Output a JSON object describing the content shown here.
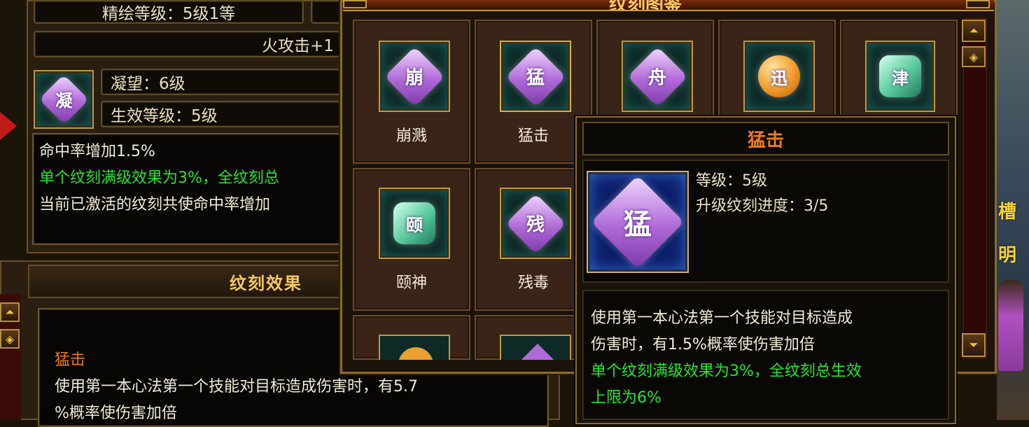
{
  "left_panel": {
    "refine_level_label": "精绘等级：5级1等",
    "fire_attack_label": "火攻击+1",
    "icon_char": "凝",
    "gaze_label": "凝望：6级",
    "effect_level_label": "生效等级：5级",
    "desc_lines": [
      "命中率增加1.5%",
      "单个纹刻满级效果为3%，全纹刻总",
      "当前已激活的纹刻共使命中率增加"
    ]
  },
  "effects_panel": {
    "title": "纹刻效果",
    "entry_name": "猛击",
    "entry_desc_line1": "使用第一本心法第一个技能对目标造成伤害时，有5.7",
    "entry_desc_line2": "%概率使伤害加倍"
  },
  "grid_window": {
    "title": "纹刻图鉴",
    "cells": [
      {
        "icon_char": "崩",
        "label": "崩溅",
        "icon_style": "purple"
      },
      {
        "icon_char": "猛",
        "label": "猛击",
        "icon_style": "purple"
      },
      {
        "icon_char": "舟",
        "label": "",
        "icon_style": "purple"
      },
      {
        "icon_char": "迅",
        "label": "",
        "icon_style": "orange"
      },
      {
        "icon_char": "津",
        "label": "",
        "icon_style": "teal"
      },
      {
        "icon_char": "颐",
        "label": "颐神",
        "icon_style": "teal"
      },
      {
        "icon_char": "残",
        "label": "残毒",
        "icon_style": "purple"
      }
    ]
  },
  "tooltip": {
    "title": "猛击",
    "icon_char": "猛",
    "level_label": "等级：5级",
    "progress_label": "升级纹刻进度：3/5",
    "desc_line1": "使用第一本心法第一个技能对目标造成",
    "desc_line2": "伤害时，有1.5%概率使伤害加倍",
    "desc_line3": "单个纹刻满级效果为3%，全纹刻总生效",
    "desc_line4": "上限为6%"
  },
  "background_right": {
    "text1": "槽",
    "text2": "明"
  },
  "colors": {
    "green_text": "#21e82a",
    "orange_title": "#f07a1a",
    "gold_title": "#f4c866"
  }
}
